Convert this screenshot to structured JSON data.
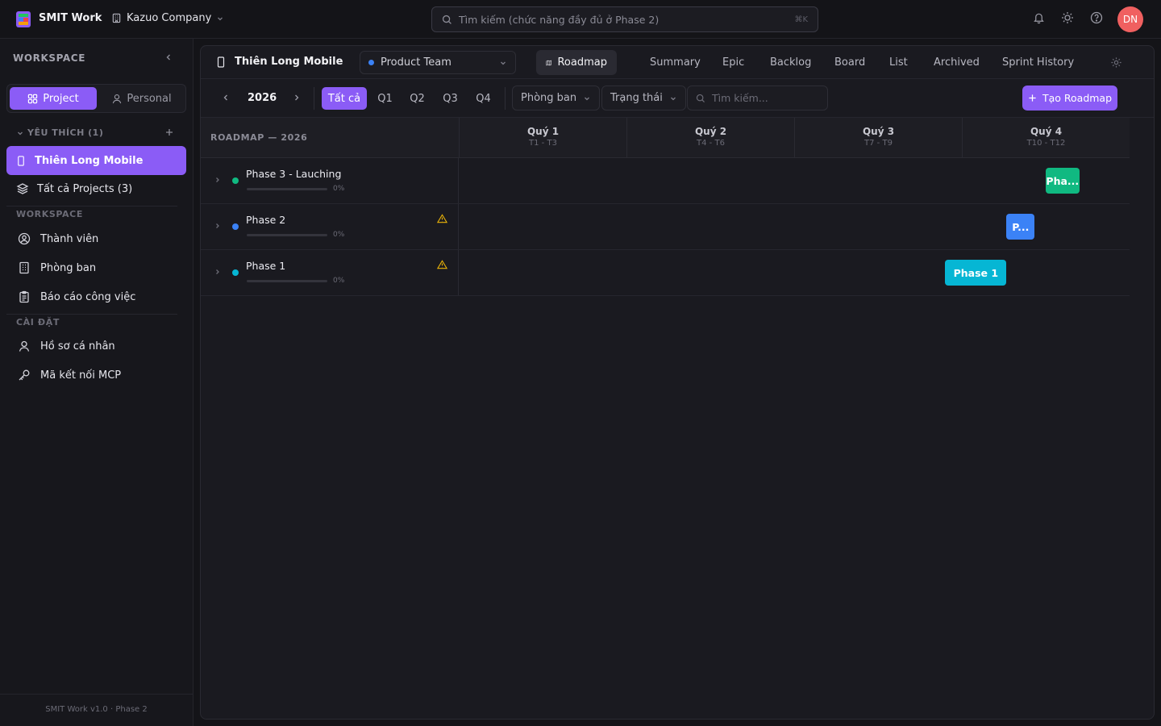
{
  "app": {
    "name": "SMIT Work",
    "company": "Kazuo Company"
  },
  "search": {
    "placeholder": "Tìm kiếm (chức năng đầy đủ ở Phase 2)",
    "shortcut": "⌘K"
  },
  "user": {
    "initials": "DN"
  },
  "sidebar": {
    "title": "WORKSPACE",
    "segments": {
      "project": "Project",
      "personal": "Personal"
    },
    "favorites_label": "YÊU THÍCH (1)",
    "favorites": [
      {
        "label": "Thiên Long Mobile"
      }
    ],
    "all_projects": "Tất cả Projects (3)",
    "workspace_label": "WORKSPACE",
    "workspace_items": [
      {
        "label": "Thành viên",
        "icon": "user-circle-icon"
      },
      {
        "label": "Phòng ban",
        "icon": "building-icon"
      },
      {
        "label": "Báo cáo công việc",
        "icon": "clipboard-icon"
      }
    ],
    "settings_label": "CÀI ĐẶT",
    "settings_items": [
      {
        "label": "Hồ sơ cá nhân",
        "icon": "user-icon"
      },
      {
        "label": "Mã kết nối MCP",
        "icon": "key-icon"
      }
    ],
    "footer": "SMIT Work v1.0 · Phase 2"
  },
  "project": {
    "title": "Thiên Long Mobile",
    "team": "Product Team",
    "tabs": [
      {
        "label": "Roadmap",
        "active": true
      },
      {
        "label": "Summary"
      },
      {
        "label": "Epic"
      },
      {
        "label": "Backlog"
      },
      {
        "label": "Board"
      },
      {
        "label": "List"
      },
      {
        "label": "Archived"
      },
      {
        "label": "Sprint History"
      }
    ]
  },
  "toolbar": {
    "year": "2026",
    "quarters": [
      {
        "label": "Tất cả",
        "active": true
      },
      {
        "label": "Q1"
      },
      {
        "label": "Q2"
      },
      {
        "label": "Q3"
      },
      {
        "label": "Q4"
      }
    ],
    "filter_department": "Phòng ban",
    "filter_status": "Trạng thái",
    "search_placeholder": "Tìm kiếm...",
    "create_label": "Tạo Roadmap"
  },
  "roadmap": {
    "header_label": "ROADMAP — 2026",
    "quarters": [
      {
        "name": "Quý 1",
        "months": "T1 - T3"
      },
      {
        "name": "Quý 2",
        "months": "T4 - T6"
      },
      {
        "name": "Quý 3",
        "months": "T7 - T9"
      },
      {
        "name": "Quý 4",
        "months": "T10 - T12"
      }
    ],
    "rows": [
      {
        "name": "Phase 3 - Lauching",
        "progress": 0,
        "progress_label": "0%",
        "dot_color": "#10b981",
        "bar_color": "#10b981",
        "bar_label": "Pha...",
        "warning": false,
        "start_month": 10.5,
        "end_month": 11.1
      },
      {
        "name": "Phase 2",
        "progress": 0,
        "progress_label": "0%",
        "dot_color": "#3b82f6",
        "bar_color": "#3b82f6",
        "bar_label": "P...",
        "warning": true,
        "start_month": 9.8,
        "end_month": 10.3
      },
      {
        "name": "Phase 1",
        "progress": 0,
        "progress_label": "0%",
        "dot_color": "#06b6d4",
        "bar_color": "#06b6d4",
        "bar_label": "Phase 1",
        "warning": true,
        "start_month": 8.7,
        "end_month": 9.8
      }
    ]
  }
}
